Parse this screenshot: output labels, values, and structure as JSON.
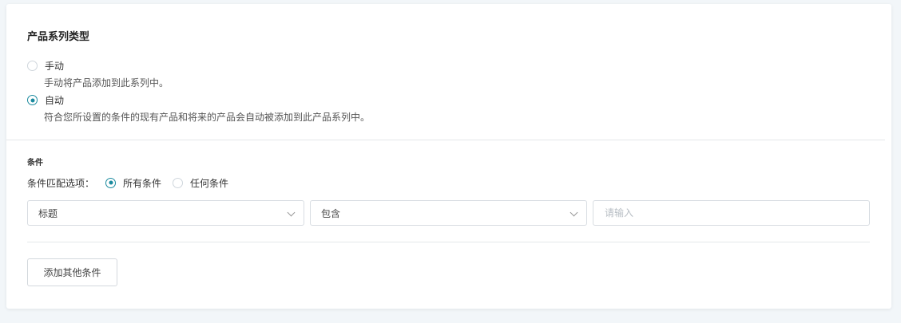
{
  "section": {
    "title": "产品系列类型",
    "options": [
      {
        "label": "手动",
        "description": "手动将产品添加到此系列中。",
        "checked": false
      },
      {
        "label": "自动",
        "description": "符合您所设置的条件的现有产品和将来的产品会自动被添加到此产品系列中。",
        "checked": true
      }
    ]
  },
  "conditions": {
    "title": "条件",
    "match_label": "条件匹配选项：",
    "match_options": [
      {
        "label": "所有条件",
        "checked": true
      },
      {
        "label": "任何条件",
        "checked": false
      }
    ],
    "field_select": "标题",
    "operator_select": "包含",
    "value_placeholder": "请输入",
    "add_button": "添加其他条件"
  },
  "colors": {
    "accent": "#1a8a9e",
    "background": "#f2f6f9",
    "card": "#ffffff"
  }
}
